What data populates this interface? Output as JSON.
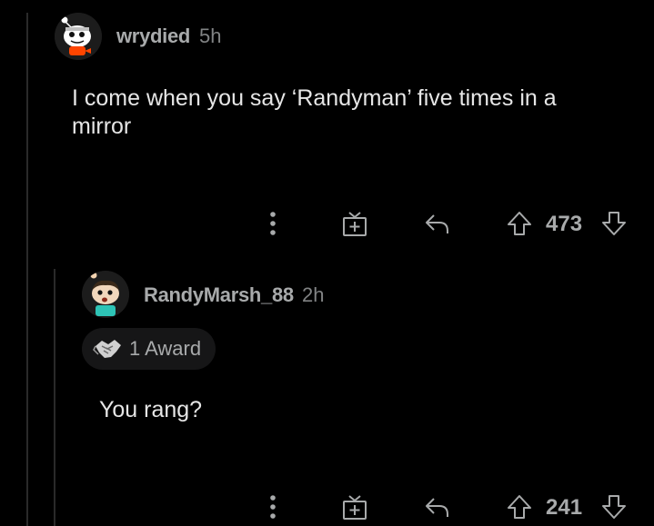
{
  "comments": [
    {
      "username": "wrydied",
      "time": "5h",
      "text": "I come when you say ‘Randyman’ five times in a mirror",
      "score": "473"
    },
    {
      "username": "RandyMarsh_88",
      "time": "2h",
      "award": "1 Award",
      "text": "You rang?",
      "score": "241"
    }
  ],
  "icons": {
    "more": "more-vertical-icon",
    "gift": "gift-award-icon",
    "reply": "reply-icon",
    "upvote": "upvote-arrow-icon",
    "downvote": "downvote-arrow-icon",
    "award": "handshake-award-icon"
  },
  "colors": {
    "background": "#000000",
    "text": "#e6e6e6",
    "muted": "#a8aaab",
    "thread_line": "#2a2a2a"
  }
}
